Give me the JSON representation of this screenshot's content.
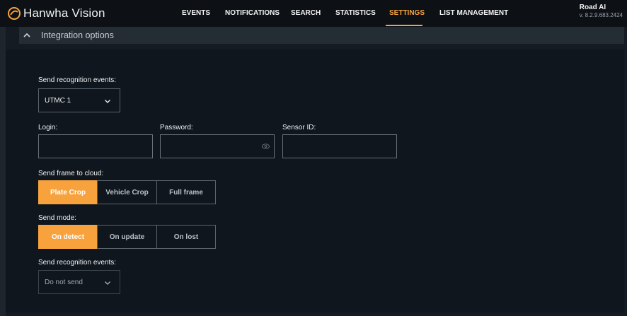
{
  "app": {
    "brand": "Hanwha Vision",
    "product_name": "Road AI",
    "product_version": "v. 8.2.9.683.2424",
    "accent_color": "#f7a23c"
  },
  "nav": {
    "items": [
      "EVENTS",
      "NOTIFICATIONS",
      "SEARCH",
      "STATISTICS",
      "SETTINGS",
      "LIST MANAGEMENT"
    ],
    "active": "SETTINGS"
  },
  "section": {
    "title": "Integration options",
    "icon": "chevron-up-icon"
  },
  "form": {
    "send_events_label": "Send recognition events:",
    "send_events_value": "UTMC 1",
    "login_label": "Login:",
    "login_value": "",
    "password_label": "Password:",
    "password_value": "",
    "sensor_label": "Sensor ID:",
    "sensor_value": "",
    "frame_label": "Send frame to cloud:",
    "frame_options": [
      "Plate Crop",
      "Vehicle Crop",
      "Full frame"
    ],
    "frame_selected": "Plate Crop",
    "mode_label": "Send mode:",
    "mode_options": [
      "On detect",
      "On update",
      "On lost"
    ],
    "mode_selected": "On detect",
    "send_events2_label": "Send recognition events:",
    "send_events2_value": "Do not send"
  }
}
